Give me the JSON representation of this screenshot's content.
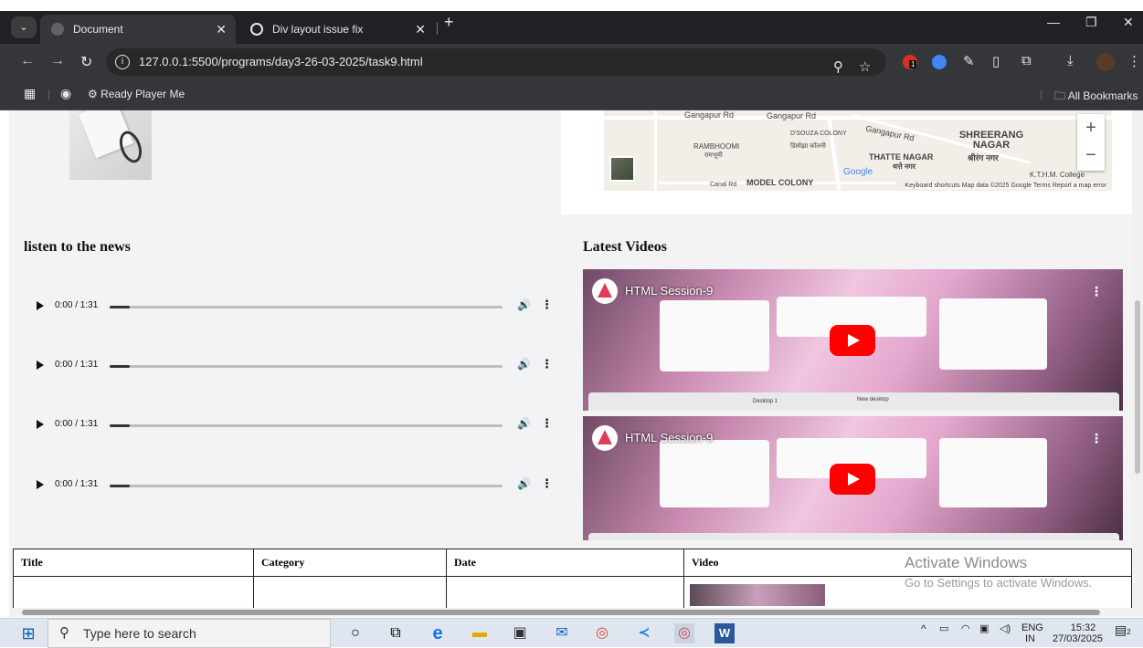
{
  "browser": {
    "tabs": [
      {
        "title": "Document",
        "active": true
      },
      {
        "title": "Div layout issue fix",
        "active": false
      }
    ],
    "url": "127.0.0.1:5500/programs/day3-26-03-2025/task9.html",
    "bookmarks": [
      "Ready Player Me"
    ],
    "all_bookmarks_label": "All Bookmarks",
    "extension_badge": "1"
  },
  "map": {
    "labels": [
      "Gangapur Rd",
      "Gangapur Rd",
      "D'SOUZA COLONY",
      "डिसोझा कॉलनी",
      "RAMBHOOMI",
      "रामभूमी",
      "THATTE NAGAR",
      "थत्ते नगर",
      "SHREERANG NAGAR",
      "श्रीरंग नगर",
      "MODEL COLONY",
      "Canal Rd",
      "K.T.H.M. College",
      "Google"
    ],
    "footer": "Keyboard shortcuts  Map data ©2025 Google  Terms  Report a map error",
    "zoom_in": "+",
    "zoom_out": "−"
  },
  "news": {
    "heading": "listen to the news",
    "tracks": [
      {
        "time": "0:00 / 1:31",
        "progress": 0.05
      },
      {
        "time": "0:00 / 1:31",
        "progress": 0.05
      },
      {
        "time": "0:00 / 1:31",
        "progress": 0.05
      },
      {
        "time": "0:00 / 1:31",
        "progress": 0.05
      }
    ]
  },
  "videos": {
    "heading": "Latest Videos",
    "items": [
      {
        "title": "HTML Session-9",
        "bar_left": "Desktop 1",
        "bar_right": "New desktop"
      },
      {
        "title": "HTML Session-9",
        "bar_left": "",
        "bar_right": ""
      }
    ]
  },
  "table": {
    "headers": [
      "Title",
      "Category",
      "Date",
      "Video"
    ]
  },
  "watermark": {
    "line1": "Activate Windows",
    "line2": "Go to Settings to activate Windows."
  },
  "taskbar": {
    "search_placeholder": "Type here to search",
    "lang": "ENG",
    "region": "IN",
    "time": "15:32",
    "date": "27/03/2025",
    "notifications": "2"
  }
}
